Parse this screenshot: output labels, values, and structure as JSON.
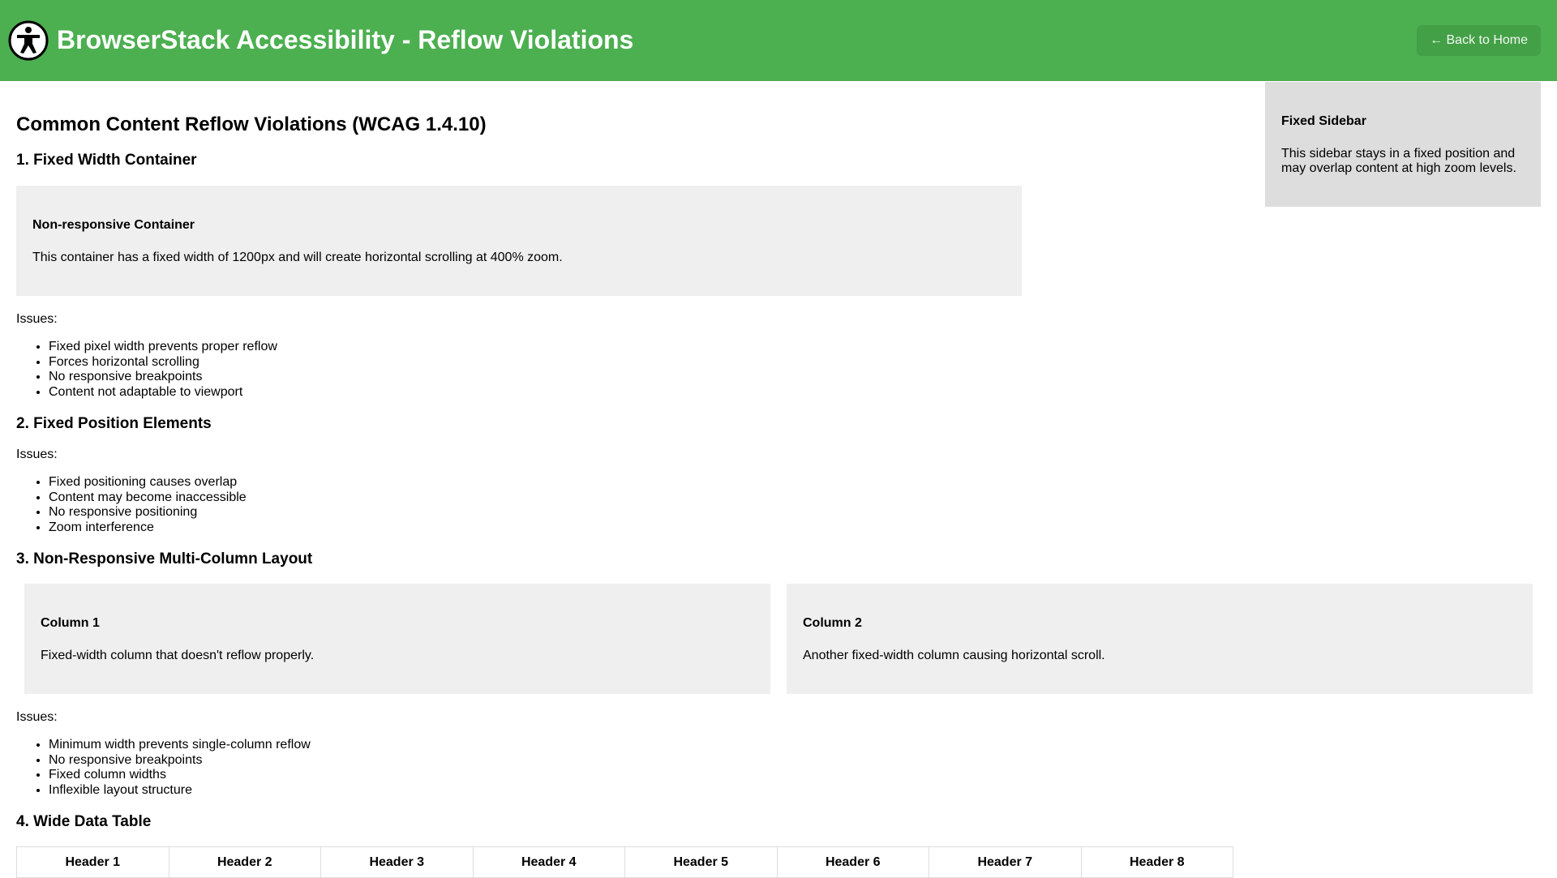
{
  "header": {
    "title": "BrowserStack Accessibility - Reflow Violations",
    "back_label": "← Back to Home",
    "logo_icon": "accessibility-icon",
    "bg_color": "#4caf50"
  },
  "sidebar": {
    "title": "Fixed Sidebar",
    "text": "This sidebar stays in a fixed position and may overlap content at high zoom levels."
  },
  "main": {
    "heading": "Common Content Reflow Violations (WCAG 1.4.10)",
    "sections": [
      {
        "title": "1. Fixed Width Container",
        "box": {
          "title": "Non-responsive Container",
          "text": "This container has a fixed width of 1200px and will create horizontal scrolling at 400% zoom."
        },
        "issues_label": "Issues:",
        "issues": [
          "Fixed pixel width prevents proper reflow",
          "Forces horizontal scrolling",
          "No responsive breakpoints",
          "Content not adaptable to viewport"
        ]
      },
      {
        "title": "2. Fixed Position Elements",
        "issues_label": "Issues:",
        "issues": [
          "Fixed positioning causes overlap",
          "Content may become inaccessible",
          "No responsive positioning",
          "Zoom interference"
        ]
      },
      {
        "title": "3. Non-Responsive Multi-Column Layout",
        "columns": [
          {
            "title": "Column 1",
            "text": "Fixed-width column that doesn't reflow properly."
          },
          {
            "title": "Column 2",
            "text": "Another fixed-width column causing horizontal scroll."
          }
        ],
        "issues_label": "Issues:",
        "issues": [
          "Minimum width prevents single-column reflow",
          "No responsive breakpoints",
          "Fixed column widths",
          "Inflexible layout structure"
        ]
      },
      {
        "title": "4. Wide Data Table",
        "table_headers": [
          "Header 1",
          "Header 2",
          "Header 3",
          "Header 4",
          "Header 5",
          "Header 6",
          "Header 7",
          "Header 8"
        ]
      }
    ]
  }
}
